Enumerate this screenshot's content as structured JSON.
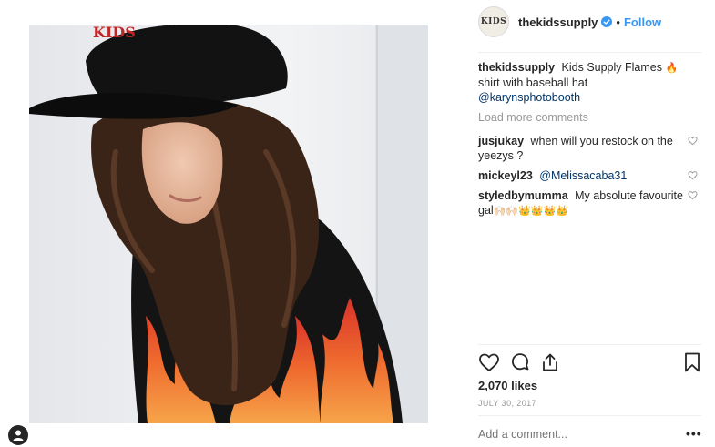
{
  "post": {
    "username": "thekidssupply",
    "avatar_text": "KIDS",
    "follow_label": "Follow",
    "dot": "•",
    "caption": {
      "user": "thekidssupply",
      "text_before": "Kids Supply Flames",
      "fire_emoji": "🔥",
      "text_after": " shirt with baseball hat",
      "mention": "@karynsphotobooth"
    },
    "load_more_label": "Load more comments",
    "comments": [
      {
        "user": "jusjukay",
        "text": "when will you restock on the yeezys ?",
        "mention": ""
      },
      {
        "user": "mickeyl23",
        "text": "",
        "mention": "@Melissacaba31"
      },
      {
        "user": "styledbymumma",
        "text": "My absolute favourite gal",
        "emojis": "🙌🏻🙌🏻👑👑👑👑",
        "mention": ""
      }
    ],
    "likes": "2,070 likes",
    "date": "JULY 30, 2017",
    "add_comment_placeholder": "Add a comment...",
    "more_label": "•••",
    "hat_text": "KIDS"
  },
  "colors": {
    "link_blue": "#3897f0",
    "mention_blue": "#003569",
    "muted_gray": "#999999",
    "text": "#262626",
    "verified_blue": "#3897f0"
  },
  "icons": [
    "heart-icon",
    "comment-icon",
    "share-icon",
    "bookmark-icon",
    "verified-badge-icon",
    "profile-icon"
  ]
}
